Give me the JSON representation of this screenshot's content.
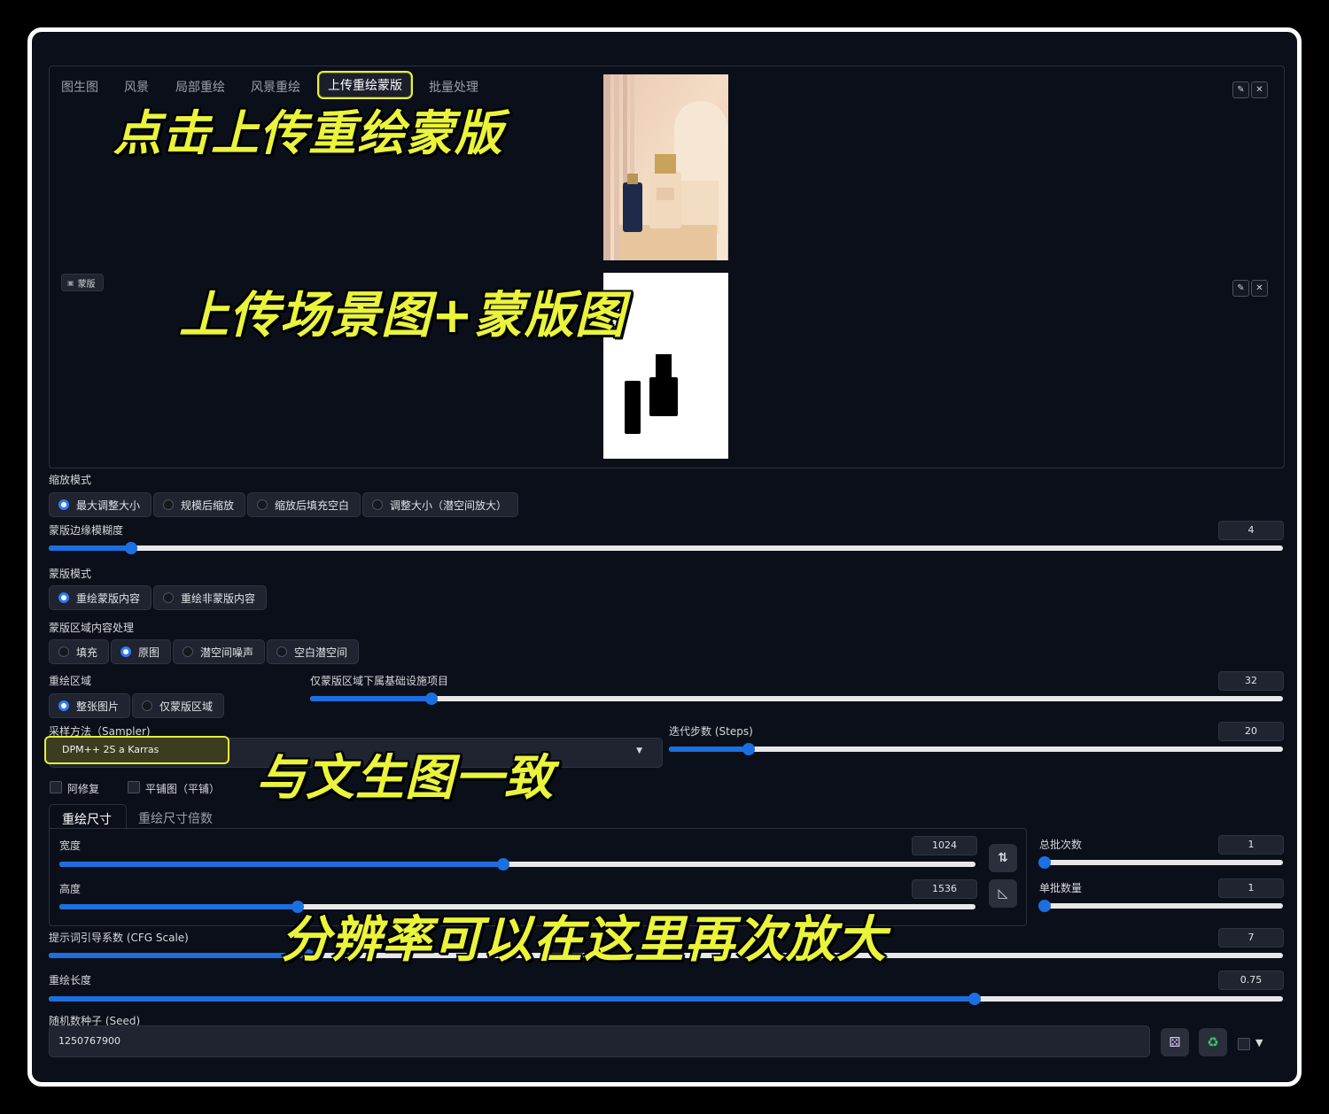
{
  "tabs": [
    "图生图",
    "风景",
    "局部重绘",
    "风景重绘",
    "上传重绘蒙版",
    "批量处理"
  ],
  "active_tab": "上传重绘蒙版",
  "mask_badge": "蒙版",
  "captions": {
    "upload_mask": "点击上传重绘蒙版",
    "upload_scene": "上传场景图+蒙版图",
    "same_as_txt2img": "与文生图一致",
    "resolution": "分辨率可以在这里再次放大"
  },
  "resize_mode": {
    "label": "缩放模式",
    "options": [
      "最大调整大小",
      "规模后缩放",
      "缩放后填充空白",
      "调整大小（潜空间放大）"
    ],
    "selected": 0
  },
  "mask_blur": {
    "label": "蒙版边缘模糊度",
    "value": "4",
    "fraction": 0.067
  },
  "mask_mode": {
    "label": "蒙版模式",
    "options": [
      "重绘蒙版内容",
      "重绘非蒙版内容"
    ],
    "selected": 0
  },
  "masked_content": {
    "label": "蒙版区域内容处理",
    "options": [
      "填充",
      "原图",
      "潜空间噪声",
      "空白潜空间"
    ],
    "selected": 1
  },
  "inpaint_area": {
    "label": "重绘区域",
    "options": [
      "整张图片",
      "仅蒙版区域"
    ],
    "selected": 0
  },
  "only_masked_padding": {
    "label": "仅蒙版区域下属基础设施项目",
    "value": "32",
    "fraction": 0.125
  },
  "sampler": {
    "label": "采样方法（Sampler)",
    "value": "DPM++ 2S a Karras"
  },
  "steps": {
    "label": "迭代步数 (Steps)",
    "value": "20",
    "fraction": 0.13
  },
  "restore_faces": "阿修复",
  "tiling": "平铺图（平铺）",
  "size_tabs": [
    "重绘尺寸",
    "重绘尺寸倍数"
  ],
  "width": {
    "label": "宽度",
    "value": "1024",
    "fraction": 0.485
  },
  "height": {
    "label": "高度",
    "value": "1536",
    "fraction": 0.26
  },
  "batch_count": {
    "label": "总批次数",
    "value": "1",
    "fraction": 0.0
  },
  "batch_size": {
    "label": "单批数量",
    "value": "1",
    "fraction": 0.0
  },
  "cfg_scale": {
    "label": "提示词引导系数 (CFG Scale)",
    "value": "7",
    "fraction": 0.21
  },
  "denoising": {
    "label": "重绘长度",
    "value": "0.75",
    "fraction": 0.75
  },
  "seed": {
    "label": "随机数种子 (Seed)",
    "value": "1250767900"
  },
  "colors": {
    "accent": "#1c6fe0",
    "highlight": "#e6ef3c",
    "background": "#0b0f19"
  },
  "icons": [
    "edit-icon",
    "close-icon",
    "image-icon",
    "swap-icon",
    "ratio-icon",
    "dice-icon",
    "recycle-icon",
    "dropdown-arrow-icon"
  ]
}
